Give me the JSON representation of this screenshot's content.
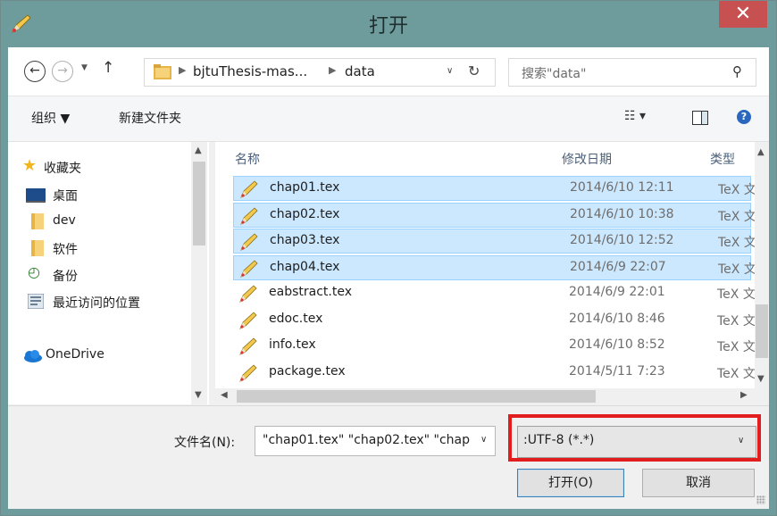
{
  "window": {
    "title": "打开",
    "close": "✕"
  },
  "nav": {
    "back": "←",
    "forward": "→",
    "up": "↑",
    "breadcrumb": [
      "bjtuThesis-mas...",
      "data"
    ],
    "search_placeholder": "搜索\"data\""
  },
  "toolbar": {
    "organize": "组织 ▼",
    "new_folder": "新建文件夹",
    "view": "☷ ▾"
  },
  "sidebar": {
    "favorites": "收藏夹",
    "items": [
      "桌面",
      "dev",
      "软件",
      "备份",
      "最近访问的位置"
    ],
    "onedrive": "OneDrive"
  },
  "columns": {
    "name": "名称",
    "date": "修改日期",
    "type": "类型"
  },
  "files": [
    {
      "name": "chap01.tex",
      "date": "2014/6/10 12:11",
      "type": "TeX 文",
      "selected": true
    },
    {
      "name": "chap02.tex",
      "date": "2014/6/10 10:38",
      "type": "TeX 文",
      "selected": true
    },
    {
      "name": "chap03.tex",
      "date": "2014/6/10 12:52",
      "type": "TeX 文",
      "selected": true
    },
    {
      "name": "chap04.tex",
      "date": "2014/6/9 22:07",
      "type": "TeX 文",
      "selected": true
    },
    {
      "name": "eabstract.tex",
      "date": "2014/6/9 22:01",
      "type": "TeX 文",
      "selected": false
    },
    {
      "name": "edoc.tex",
      "date": "2014/6/10 8:46",
      "type": "TeX 文",
      "selected": false
    },
    {
      "name": "info.tex",
      "date": "2014/6/10 8:52",
      "type": "TeX 文",
      "selected": false
    },
    {
      "name": "package.tex",
      "date": "2014/5/11 7:23",
      "type": "TeX 文",
      "selected": false
    }
  ],
  "bottom": {
    "filename_label": "文件名(N):",
    "filename_value": "\"chap01.tex\" \"chap02.tex\" \"chap",
    "filetype": ":UTF-8 (*.*)",
    "open": "打开(O)",
    "cancel": "取消"
  },
  "colors": {
    "selection": "#cce8ff",
    "highlight_box": "#e11d1d",
    "close_button": "#c75050",
    "frame": "#6e9c9d"
  }
}
